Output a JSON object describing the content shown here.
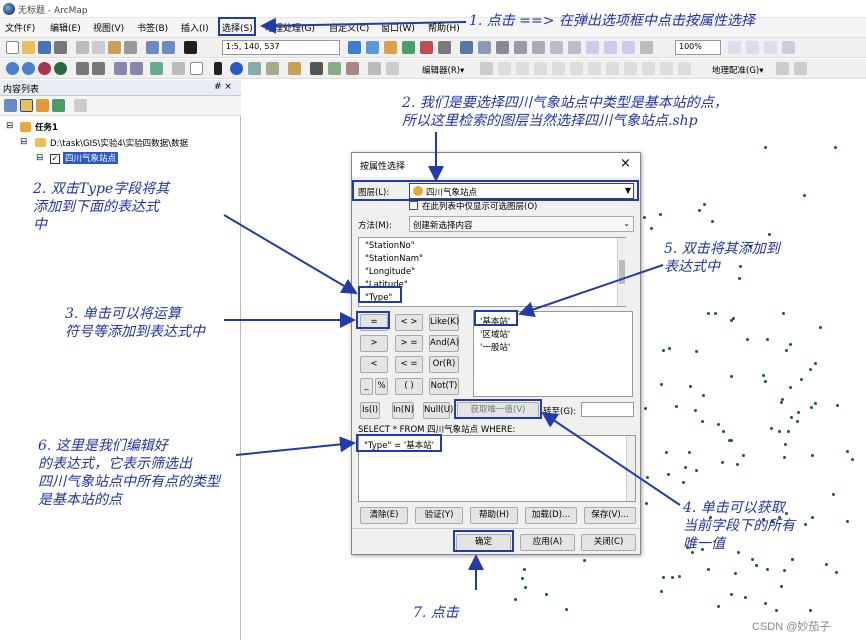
{
  "window": {
    "title": "无标题 - ArcMap"
  },
  "menu": [
    "文件(F)",
    "编辑(E)",
    "视图(V)",
    "书签(B)",
    "插入(I)",
    "选择(S)",
    "地理处理(G)",
    "自定义(C)",
    "窗口(W)",
    "帮助(H)"
  ],
  "toolbar": {
    "scale": "1:5, 140, 537",
    "zoom": "100%",
    "editor": "编辑器(R)▾",
    "georef": "地理配准(G)▾"
  },
  "toc": {
    "title": "内容列表",
    "pin": "# ×",
    "task": "任务1",
    "folder": "D:\\task\\GIS\\实验4\\实验四数据\\数据",
    "layer": "四川气象站点"
  },
  "dialog": {
    "title": "按属性选择",
    "close": "×",
    "layer_label": "图层(L):",
    "layer_value": "四川气象站点",
    "only_selectable": "在此列表中仅显示可选图层(O)",
    "method_label": "方法(M):",
    "method_value": "创建新选择内容",
    "fields": [
      "\"StationNo\"",
      "\"StationNam\"",
      "\"Longitude\"",
      "\"Latitude\"",
      "\"Type\""
    ],
    "operators": [
      "=",
      "< >",
      "Like(K)",
      ">",
      "> =",
      "And(A)",
      "<",
      "< =",
      "Or(R)",
      "_",
      "%",
      "( )",
      "Not(T)"
    ],
    "values": [
      "'基本站'",
      "'区域站'",
      "'一般站'"
    ],
    "is": "Is(I)",
    "in": "In(N)",
    "null": "Null(U)",
    "get_unique": "获取唯一值(V)",
    "goto": "转至(G):",
    "sql_header": "SELECT * FROM 四川气象站点 WHERE:",
    "expression": "\"Type\" = '基本站'",
    "clear": "清除(E)",
    "verify": "验证(Y)",
    "help": "帮助(H)",
    "load": "加载(D)...",
    "save": "保存(V)...",
    "ok": "确定",
    "apply": "应用(A)",
    "cancel": "关闭(C)"
  },
  "notes": {
    "n1": "1. 点击 ==> 在弹出选项框中点击按属性选择",
    "n2": "2. 我们是要选择四川气象站点中类型是基本站的点，\n所以这里检索的图层当然选择四川气象站点.shp",
    "n2b": "2. 双击Type字段将其\n添加到下面的表达式\n中",
    "n3": "3. 单击可以将运算\n符号等添加到表达式中",
    "n4": "4. 单击可以获取\n当前字段下的所有\n唯一值",
    "n5": "5. 双击将其添加到\n表达式中",
    "n6": "6. 这里是我们编辑好\n的表达式，它表示筛选出\n四川气象站点中所有点的类型\n是基本站的点",
    "n7": "7. 点击"
  },
  "watermark": "CSDN @妙茄子"
}
